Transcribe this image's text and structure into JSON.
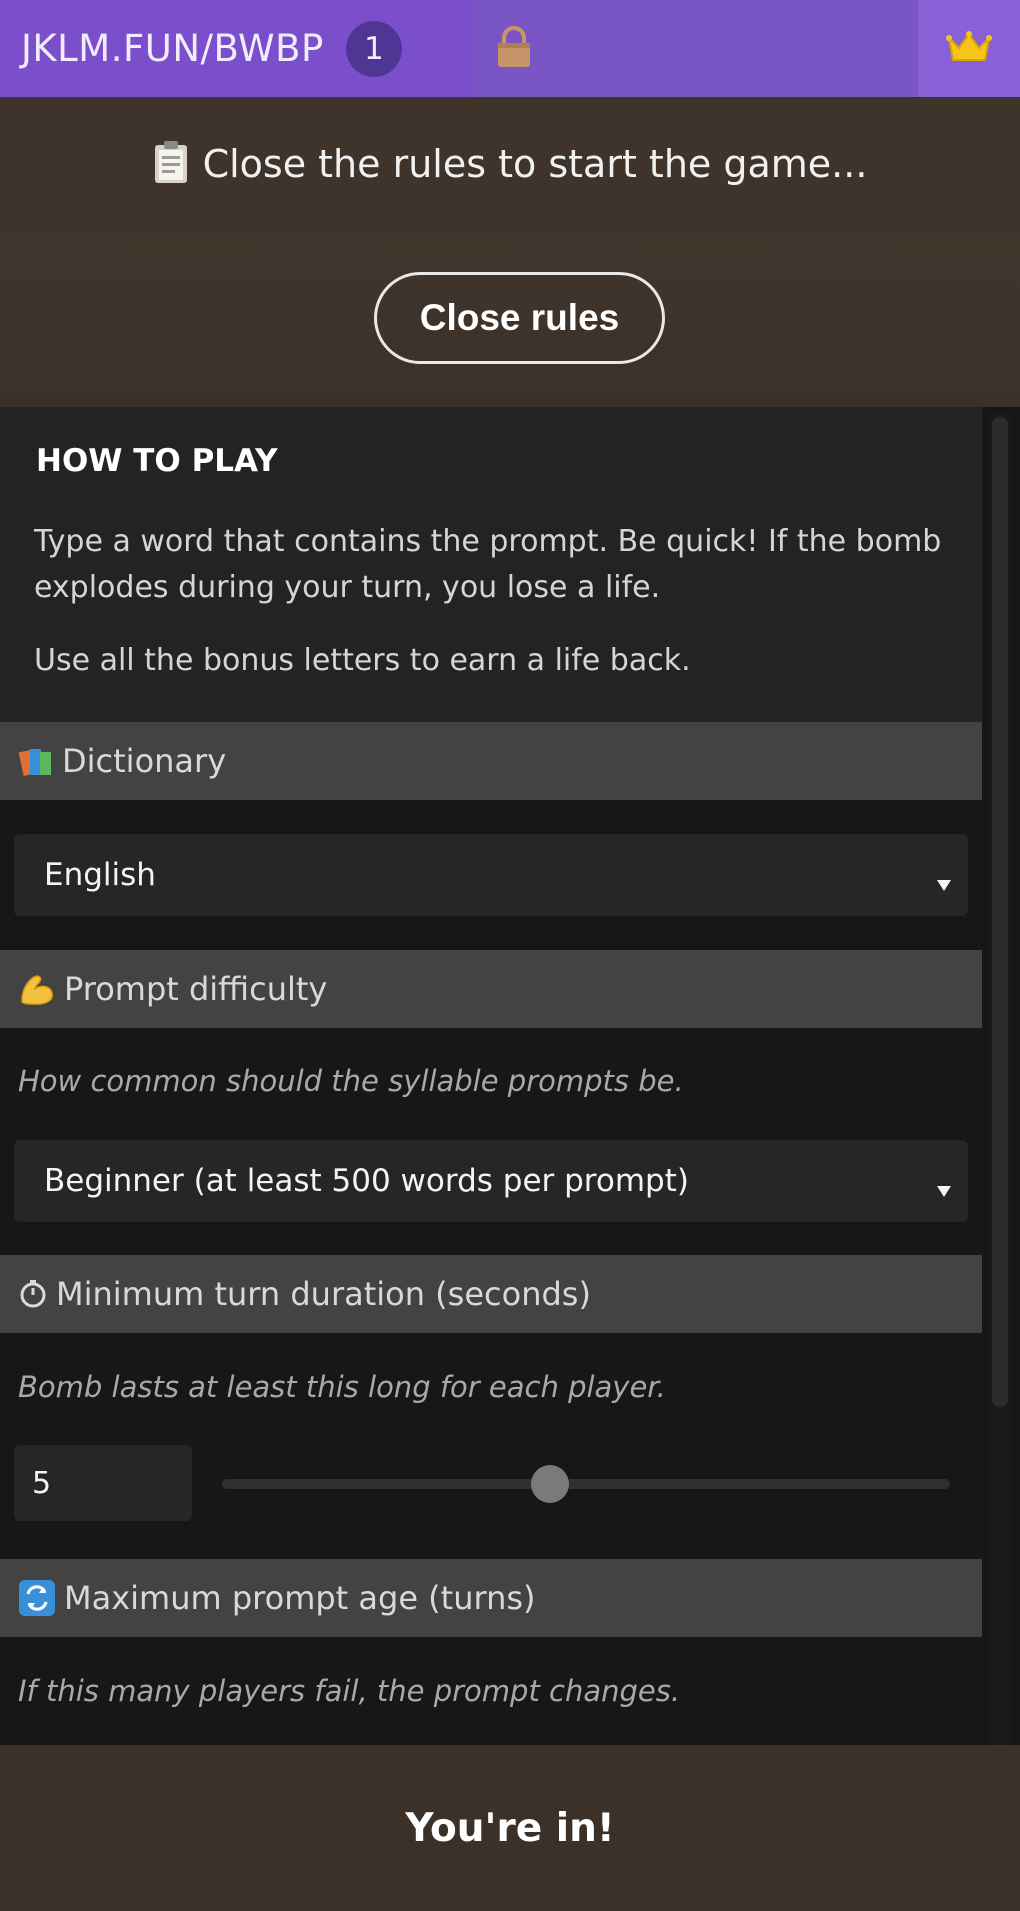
{
  "header": {
    "room_code": "JKLM.FUN/BWBP",
    "player_count": "1",
    "lock_icon": "lock-icon",
    "crown_icon": "crown-icon"
  },
  "status": {
    "icon": "clipboard-icon",
    "text": "Close the rules to start the game...",
    "close_rules_label": "Close rules"
  },
  "how_to_play": {
    "title": "HOW TO PLAY",
    "paragraph_1": "Type a word that contains the prompt. Be quick! If the bomb explodes during your turn, you lose a life.",
    "paragraph_2": "Use all the bonus letters to earn a life back."
  },
  "settings": {
    "dictionary": {
      "icon": "books-icon",
      "label": "Dictionary",
      "selected": "English"
    },
    "prompt_difficulty": {
      "icon": "flexed-biceps-icon",
      "label": "Prompt difficulty",
      "hint": "How common should the syllable prompts be.",
      "selected": "Beginner (at least 500 words per prompt)"
    },
    "min_turn_duration": {
      "icon": "timer-icon",
      "label": "Minimum turn duration (seconds)",
      "hint": "Bomb lasts at least this long for each player.",
      "value": "5",
      "slider_fraction": 0.45
    },
    "max_prompt_age": {
      "icon": "repeat-icon",
      "label": "Maximum prompt age (turns)",
      "hint": "If this many players fail, the prompt changes."
    }
  },
  "footer": {
    "text": "You're in!"
  },
  "colors": {
    "accent_purple": "#7b4fcc",
    "status_brown": "#3e342b",
    "panel_dark": "#171717",
    "section_header": "#434343"
  }
}
